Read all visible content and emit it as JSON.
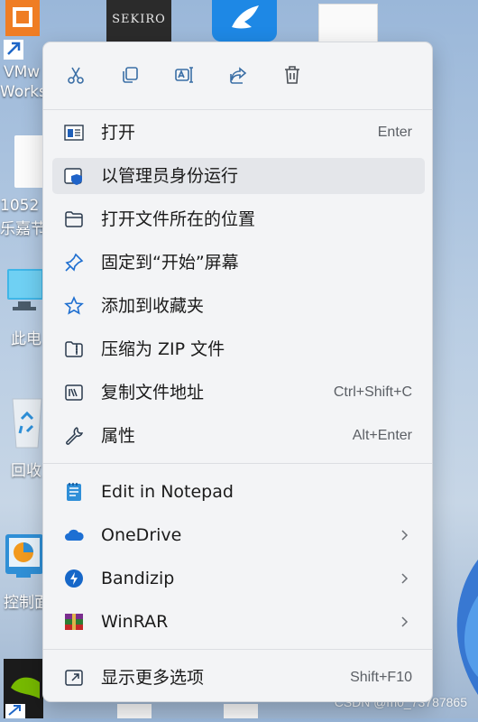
{
  "desktop": {
    "icons": [
      {
        "name": "vmware-shortcut",
        "label_line1": "VMw",
        "label_line2": "Works"
      },
      {
        "name": "document-file",
        "label_line1": "1052",
        "label_line2": "乐嘉节("
      },
      {
        "name": "this-pc",
        "label_line1": "此电"
      },
      {
        "name": "recycle-bin",
        "label_line1": "回收"
      },
      {
        "name": "control-panel",
        "label_line1": "控制面"
      }
    ],
    "sekiro_title": "SEKIRO",
    "watermark": "CSDN @m0_73787865"
  },
  "context_menu": {
    "quick_actions": [
      {
        "name": "cut",
        "icon": "scissors-icon"
      },
      {
        "name": "copy",
        "icon": "copy-icon"
      },
      {
        "name": "rename",
        "icon": "rename-icon"
      },
      {
        "name": "share",
        "icon": "share-icon"
      },
      {
        "name": "delete",
        "icon": "trash-icon"
      }
    ],
    "items": [
      {
        "label": "打开",
        "shortcut": "Enter"
      },
      {
        "label": "以管理员身份运行",
        "shortcut": ""
      },
      {
        "label": "打开文件所在的位置",
        "shortcut": ""
      },
      {
        "label": "固定到“开始”屏幕",
        "shortcut": ""
      },
      {
        "label": "添加到收藏夹",
        "shortcut": ""
      },
      {
        "label": "压缩为 ZIP 文件",
        "shortcut": ""
      },
      {
        "label": "复制文件地址",
        "shortcut": "Ctrl+Shift+C"
      },
      {
        "label": "属性",
        "shortcut": "Alt+Enter"
      }
    ],
    "extensions": [
      {
        "label": "Edit in Notepad"
      },
      {
        "label": "OneDrive"
      },
      {
        "label": "Bandizip"
      },
      {
        "label": "WinRAR"
      }
    ],
    "more": {
      "label": "显示更多选项",
      "shortcut": "Shift+F10"
    }
  },
  "colors": {
    "accent": "#0067c0",
    "menu_bg": "#f3f4f6",
    "hover_bg": "#e4e6ea"
  }
}
